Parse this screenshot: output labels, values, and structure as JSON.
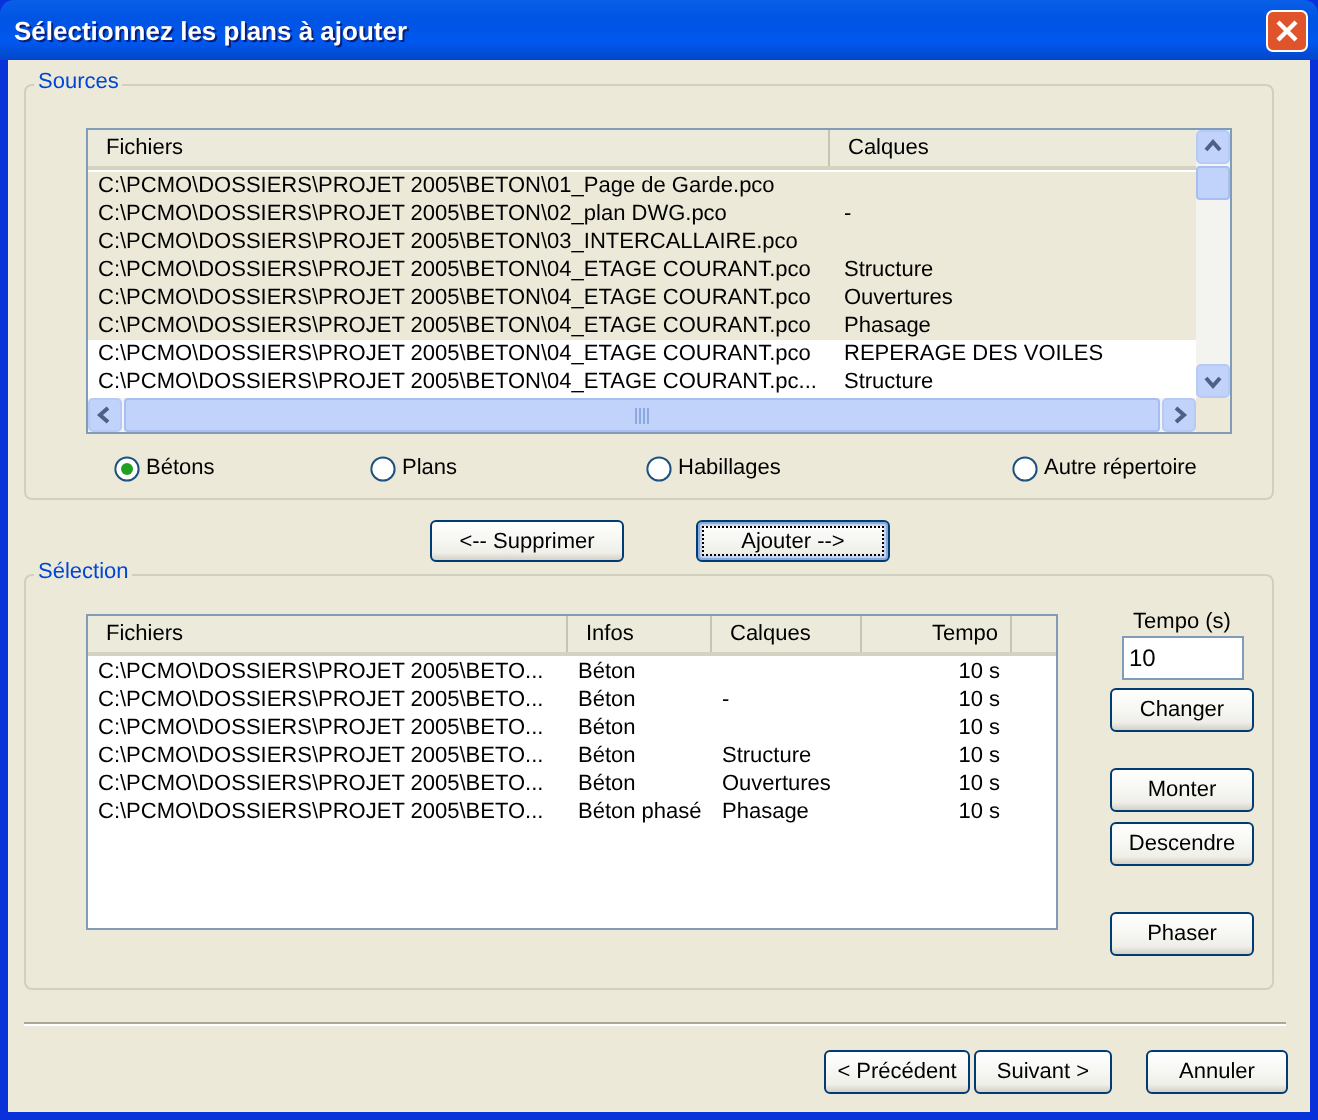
{
  "window": {
    "title": "Sélectionnez les plans à ajouter"
  },
  "sources": {
    "label": "Sources",
    "columns": [
      "Fichiers",
      "Calques"
    ],
    "rows": [
      {
        "fichier": "C:\\PCMO\\DOSSIERS\\PROJET 2005\\BETON\\01_Page de Garde.pco",
        "selected": true
      },
      {
        "fichier": "C:\\PCMO\\DOSSIERS\\PROJET 2005\\BETON\\02_plan DWG.pco",
        "calque": "-",
        "selected": true
      },
      {
        "fichier": "C:\\PCMO\\DOSSIERS\\PROJET 2005\\BETON\\03_INTERCALLAIRE.pco",
        "selected": true
      },
      {
        "fichier": "C:\\PCMO\\DOSSIERS\\PROJET 2005\\BETON\\04_ETAGE COURANT.pco",
        "calque": "Structure",
        "selected": true
      },
      {
        "fichier": "C:\\PCMO\\DOSSIERS\\PROJET 2005\\BETON\\04_ETAGE COURANT.pco",
        "calque": "Ouvertures",
        "selected": true
      },
      {
        "fichier": "C:\\PCMO\\DOSSIERS\\PROJET 2005\\BETON\\04_ETAGE COURANT.pco",
        "calque": "Phasage",
        "selected": true
      },
      {
        "fichier": "C:\\PCMO\\DOSSIERS\\PROJET 2005\\BETON\\04_ETAGE COURANT.pco",
        "calque": "REPERAGE DES VOILES",
        "selected": false
      },
      {
        "fichier": "C:\\PCMO\\DOSSIERS\\PROJET 2005\\BETON\\04_ETAGE COURANT.pc...",
        "calque": "Structure",
        "selected": false
      }
    ],
    "options": [
      {
        "label": "Bétons",
        "selected": true
      },
      {
        "label": "Plans",
        "selected": false
      },
      {
        "label": "Habillages",
        "selected": false
      },
      {
        "label": "Autre répertoire",
        "selected": false
      }
    ]
  },
  "actions": [
    {
      "label": "<-- Supprimer",
      "focused": false
    },
    {
      "label": "Ajouter -->",
      "focused": true
    }
  ],
  "selection": {
    "label": "Sélection",
    "columns": [
      "Fichiers",
      "Infos",
      "Calques",
      "Tempo"
    ],
    "rows": [
      {
        "fichier": "C:\\PCMO\\DOSSIERS\\PROJET 2005\\BETO...",
        "info": "Béton",
        "tempo": "10 s"
      },
      {
        "fichier": "C:\\PCMO\\DOSSIERS\\PROJET 2005\\BETO...",
        "info": "Béton",
        "calque": "-",
        "tempo": "10 s"
      },
      {
        "fichier": "C:\\PCMO\\DOSSIERS\\PROJET 2005\\BETO...",
        "info": "Béton",
        "tempo": "10 s"
      },
      {
        "fichier": "C:\\PCMO\\DOSSIERS\\PROJET 2005\\BETO...",
        "info": "Béton",
        "calque": "Structure",
        "tempo": "10 s"
      },
      {
        "fichier": "C:\\PCMO\\DOSSIERS\\PROJET 2005\\BETO...",
        "info": "Béton",
        "calque": "Ouvertures",
        "tempo": "10 s"
      },
      {
        "fichier": "C:\\PCMO\\DOSSIERS\\PROJET 2005\\BETO...",
        "info": "Béton phasé",
        "calque": "Phasage",
        "tempo": "10 s"
      }
    ],
    "tempo": {
      "label": "Tempo (s)",
      "value": "10"
    },
    "buttons": [
      "Changer",
      "Monter",
      "Descendre",
      "Phaser"
    ]
  },
  "footer": {
    "buttons": [
      "< Précédent",
      "Suivant >",
      "Annuler"
    ]
  }
}
